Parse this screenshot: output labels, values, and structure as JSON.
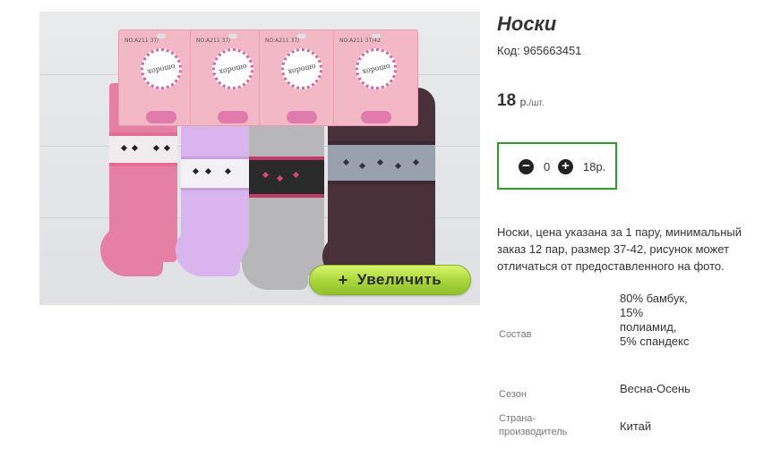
{
  "product": {
    "title": "Носки",
    "sku_label": "Код:",
    "sku": "965663451",
    "price_value": "18",
    "price_currency": "р.",
    "price_unit": "/шт.",
    "zoom_label": "Увеличить",
    "zoom_plus": "+",
    "description": "Носки, цена указана за 1 пару, минимальный заказ 12 пар, размер 37-42, рисунок может отличаться от предоставленного на фото."
  },
  "quantity": {
    "decrement": "−",
    "value": "0",
    "increment": "+",
    "total": "18р."
  },
  "image": {
    "tags": [
      {
        "code": "NO:A211   37/",
        "logo": "хорошо"
      },
      {
        "code": "NO:A211   37/",
        "logo": "хорошо"
      },
      {
        "code": "NO:A211   37/",
        "logo": "хорошо"
      },
      {
        "code": "NO:A211   37/42",
        "logo": "хорошо"
      }
    ]
  },
  "properties": [
    {
      "label": "Состав",
      "value": "80% бамбук, 15% полиамид, 5% спандекс"
    },
    {
      "label": "Сезон",
      "value": "Весна-Осень"
    },
    {
      "label": "Страна-производитель",
      "value": "Китай"
    }
  ],
  "colors": {
    "accent_green": "#2f9a2b",
    "zoom_button": "#a7d53a",
    "sock_pink": "#e57fa3",
    "sock_lilac": "#d8b5ec",
    "sock_grey": "#b7b7b9",
    "sock_brown": "#4a3038"
  }
}
